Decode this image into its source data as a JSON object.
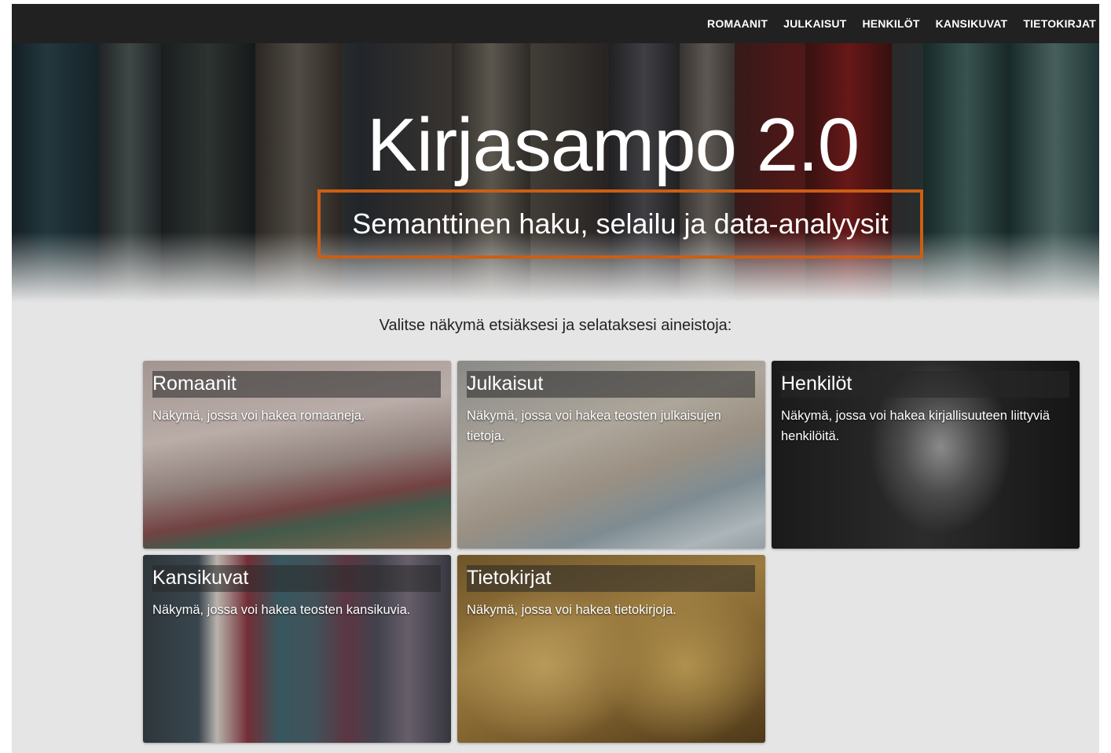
{
  "nav": {
    "items": [
      {
        "label": "ROMAANIT"
      },
      {
        "label": "JULKAISUT"
      },
      {
        "label": "HENKILÖT"
      },
      {
        "label": "KANSIKUVAT"
      },
      {
        "label": "TIETOKIRJAT"
      }
    ]
  },
  "hero": {
    "title": "Kirjasampo 2.0",
    "subtitle": "Semanttinen haku, selailu ja data-analyysit",
    "highlight_color": "#cc5e14"
  },
  "intro": "Valitse näkymä etsiäksesi ja selataksesi aineistoja:",
  "cards": [
    {
      "title": "Romaanit",
      "description": "Näkymä, jossa voi hakea romaaneja."
    },
    {
      "title": "Julkaisut",
      "description": "Näkymä, jossa voi hakea teosten julkaisujen tietoja."
    },
    {
      "title": "Henkilöt",
      "description": "Näkymä, jossa voi hakea kirjallisuuteen liittyviä henkilöitä."
    },
    {
      "title": "Kansikuvat",
      "description": "Näkymä, jossa voi hakea teosten kansikuvia."
    },
    {
      "title": "Tietokirjat",
      "description": "Näkymä, jossa voi hakea tietokirjoja."
    }
  ]
}
